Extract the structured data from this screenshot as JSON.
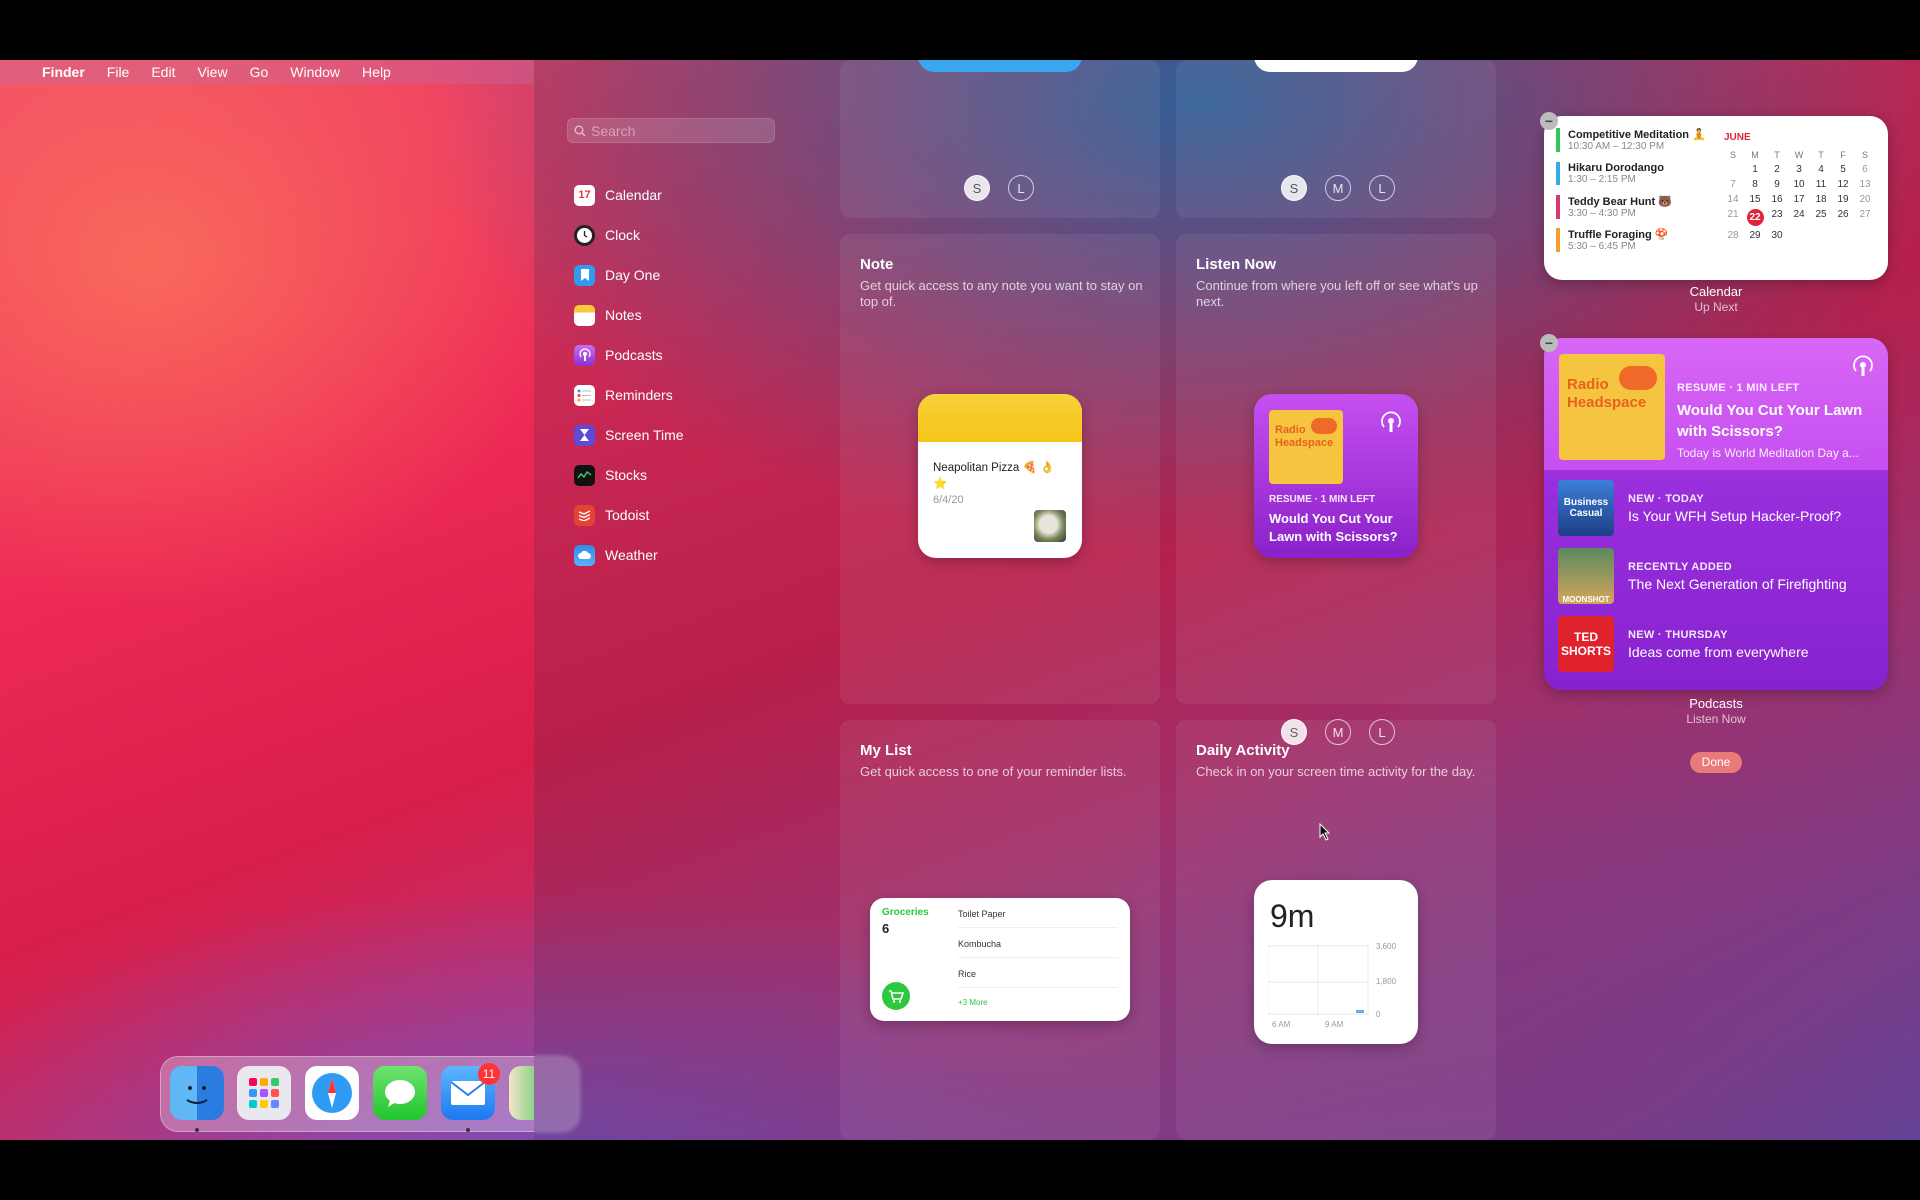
{
  "menubar": {
    "app": "Finder",
    "items": [
      "File",
      "Edit",
      "View",
      "Go",
      "Window",
      "Help"
    ]
  },
  "search": {
    "placeholder": "Search"
  },
  "sidebar": {
    "items": [
      {
        "label": "Calendar",
        "icon": "calendar-icon"
      },
      {
        "label": "Clock",
        "icon": "clock-icon"
      },
      {
        "label": "Day One",
        "icon": "bookmark-icon"
      },
      {
        "label": "Notes",
        "icon": "notes-icon"
      },
      {
        "label": "Podcasts",
        "icon": "podcasts-icon"
      },
      {
        "label": "Reminders",
        "icon": "reminders-icon"
      },
      {
        "label": "Screen Time",
        "icon": "hourglass-icon"
      },
      {
        "label": "Stocks",
        "icon": "stocks-icon"
      },
      {
        "label": "Todoist",
        "icon": "todoist-icon"
      },
      {
        "label": "Weather",
        "icon": "weather-icon"
      }
    ]
  },
  "sizes": {
    "s": "S",
    "m": "M",
    "l": "L"
  },
  "gallery": {
    "note": {
      "title": "Note",
      "desc": "Get quick access to any note you want to stay on top of.",
      "widget": {
        "text": "Neapolitan Pizza 🍕 👌 ⭐️",
        "date": "6/4/20"
      }
    },
    "listen": {
      "title": "Listen Now",
      "desc": "Continue from where you left off or see what's up next.",
      "widget": {
        "art": "Radio Headspace",
        "kicker": "RESUME · 1 MIN LEFT",
        "episode": "Would You Cut Your Lawn with Scissors?"
      }
    },
    "mylist": {
      "title": "My List",
      "desc": "Get quick access to one of your reminder lists.",
      "widget": {
        "list": "Groceries",
        "count": "6",
        "items": [
          "Toilet Paper",
          "Kombucha",
          "Rice"
        ],
        "more": "+3 More"
      }
    },
    "daily": {
      "title": "Daily Activity",
      "desc": "Check in on your screen time activity for the day.",
      "widget": {
        "value": "9m",
        "y_ticks": [
          "3,600",
          "1,800",
          "0"
        ],
        "x_ticks": [
          "6 AM",
          "9 AM"
        ]
      }
    }
  },
  "calendar_widget": {
    "events": [
      {
        "title": "Competitive Meditation 🧘",
        "time": "10:30 AM – 12:30 PM",
        "color": "#34c759"
      },
      {
        "title": "Hikaru Dorodango",
        "time": "1:30 – 2:15 PM",
        "color": "#32ade6"
      },
      {
        "title": "Teddy Bear Hunt 🐻",
        "time": "3:30 – 4:30 PM",
        "color": "#d63a6a"
      },
      {
        "title": "Truffle Foraging 🍄",
        "time": "5:30 – 6:45 PM",
        "color": "#f4a12b"
      }
    ],
    "month": "JUNE",
    "weekdays": [
      "S",
      "M",
      "T",
      "W",
      "T",
      "F",
      "S"
    ],
    "days": [
      "",
      "1",
      "2",
      "3",
      "4",
      "5",
      "6",
      "7",
      "8",
      "9",
      "10",
      "11",
      "12",
      "13",
      "14",
      "15",
      "16",
      "17",
      "18",
      "19",
      "20",
      "21",
      "22",
      "23",
      "24",
      "25",
      "26",
      "27",
      "28",
      "29",
      "30",
      "",
      "",
      "",
      ""
    ],
    "today": "22",
    "label": "Calendar",
    "sublabel": "Up Next"
  },
  "podcasts_widget": {
    "hero": {
      "art": "Radio Headspace",
      "kicker": "RESUME · 1 MIN LEFT",
      "title": "Would You Cut Your Lawn with Scissors?",
      "subtitle": "Today is World Meditation Day a..."
    },
    "items": [
      {
        "art": "Business Casual",
        "kicker": "NEW · TODAY",
        "title": "Is Your WFH Setup Hacker-Proof?"
      },
      {
        "art": "MOONSHOT",
        "kicker": "RECENTLY ADDED",
        "title": "The Next Generation of Firefighting"
      },
      {
        "art": "TED SHORTS",
        "kicker": "NEW · THURSDAY",
        "title": "Ideas come from everywhere"
      }
    ],
    "label": "Podcasts",
    "sublabel": "Listen Now"
  },
  "done_label": "Done",
  "dock": {
    "mail_badge": "11"
  }
}
